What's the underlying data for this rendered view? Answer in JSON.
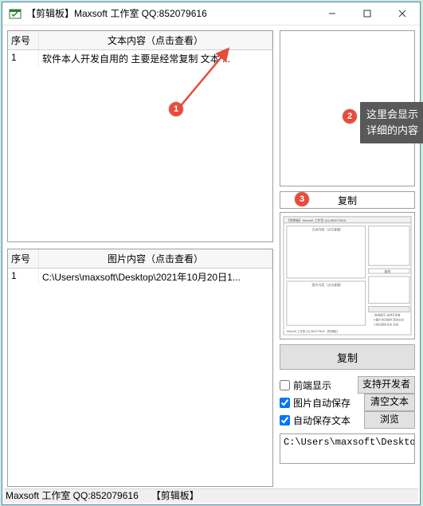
{
  "window": {
    "title": "【剪辑板】Maxsoft 工作室  QQ:852079616"
  },
  "text_grid": {
    "col_index": "序号",
    "col_content": "文本内容（点击查看）",
    "rows": [
      {
        "idx": "1",
        "content": "软件本人开发自用的  主要是经常复制 文本 ..."
      }
    ]
  },
  "image_grid": {
    "col_index": "序号",
    "col_content": "图片内容（点击查看）",
    "rows": [
      {
        "idx": "1",
        "content": "C:\\Users\\maxsoft\\Desktop\\2021年10月20日1..."
      }
    ]
  },
  "copybar": {
    "label": "复制"
  },
  "big_copy": {
    "label": "复制"
  },
  "options": {
    "front_display": "前端显示",
    "support_dev": "支持开发者",
    "img_autosave": "图片自动保存",
    "clear_text": "清空文本",
    "autosave_text": "自动保存文本",
    "browse": "浏览"
  },
  "path_value": "C:\\Users\\maxsoft\\Desktop\\",
  "status": {
    "left": "Maxsoft 工作室  QQ:852079616",
    "right": "【剪辑板】"
  },
  "annotations": {
    "b1": "1",
    "b2": "2",
    "b3": "3",
    "tooltip": "这里会显示详细的内容"
  },
  "thumb_title": "【剪辑板】Maxsoft 工作室  QQ:852079616"
}
